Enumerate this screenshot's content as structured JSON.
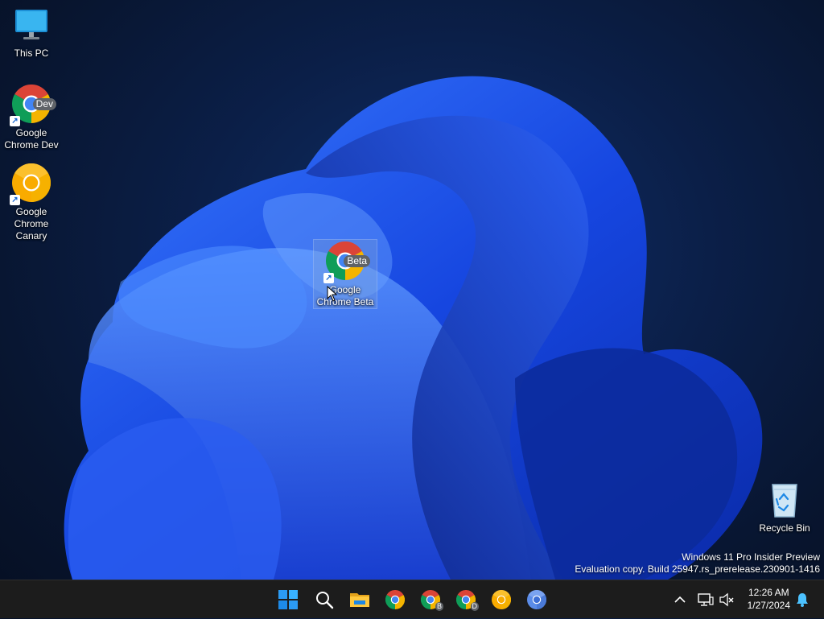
{
  "desktop": {
    "icons": [
      {
        "label": "This PC",
        "icon": "monitor-icon"
      },
      {
        "label": "Google Chrome Dev",
        "icon": "chrome-dev-icon",
        "badge": "Dev"
      },
      {
        "label": "Google Chrome Canary",
        "icon": "chrome-canary-icon"
      },
      {
        "label": "Google Chrome Beta",
        "icon": "chrome-beta-icon",
        "badge": "Beta"
      },
      {
        "label": "Recycle Bin",
        "icon": "recycle-bin-icon"
      }
    ],
    "wallpaper": "windows-11-bloom"
  },
  "watermark": {
    "line1": "Windows 11 Pro Insider Preview",
    "line2": "Evaluation copy. Build 25947.rs_prerelease.230901-1416"
  },
  "taskbar": {
    "pinned": [
      {
        "name": "start-button",
        "icon": "windows-logo-icon"
      },
      {
        "name": "search-button",
        "icon": "search-icon"
      },
      {
        "name": "file-explorer-button",
        "icon": "folder-icon"
      },
      {
        "name": "chrome-button",
        "icon": "chrome-icon"
      },
      {
        "name": "chrome-beta-button",
        "icon": "chrome-beta-icon",
        "badge": "B"
      },
      {
        "name": "chrome-dev-button",
        "icon": "chrome-dev-icon",
        "badge": "D"
      },
      {
        "name": "chrome-canary-button",
        "icon": "chrome-canary-icon"
      },
      {
        "name": "chromium-button",
        "icon": "chromium-icon"
      }
    ],
    "tray": {
      "time": "12:26 AM",
      "date": "1/27/2024"
    }
  },
  "colors": {
    "chrome_red": "#db4437",
    "chrome_green": "#0f9d58",
    "chrome_yellow": "#f4b400",
    "chrome_blue": "#4285f4",
    "canary_yellow": "#f9ab00",
    "taskbar": "#1c1c1c"
  }
}
